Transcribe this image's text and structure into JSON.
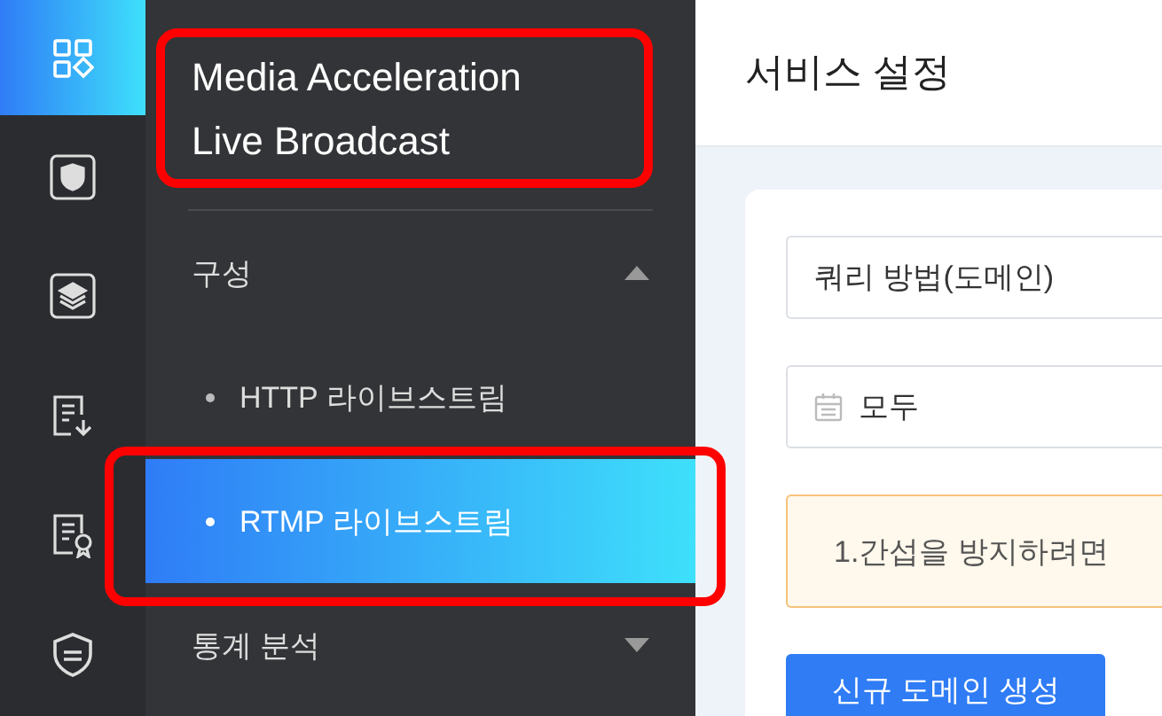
{
  "rail": [
    {
      "kind": "grid",
      "selected": true
    },
    {
      "kind": "shield",
      "selected": false
    },
    {
      "kind": "layers",
      "selected": false
    },
    {
      "kind": "download-doc",
      "selected": false
    },
    {
      "kind": "cert-doc",
      "selected": false
    },
    {
      "kind": "shield-lines",
      "selected": false
    }
  ],
  "sidebar": {
    "title": "Media Acceleration Live Broadcast",
    "groups": [
      {
        "label": "구성",
        "expanded": true,
        "children": [
          {
            "label": "HTTP 라이브스트림",
            "selected": false
          },
          {
            "label": "RTMP 라이브스트림",
            "selected": true
          }
        ]
      },
      {
        "label": "통계 분석",
        "expanded": false
      }
    ]
  },
  "main": {
    "title": "서비스 설정",
    "query_field": {
      "value": "쿼리 방법(도메인)"
    },
    "date_field": {
      "value": "모두"
    },
    "notice": "1.간섭을 방지하려면",
    "button": "신규 도메인 생성"
  }
}
